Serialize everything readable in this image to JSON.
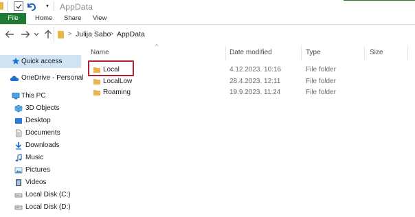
{
  "window": {
    "title": "AppData"
  },
  "ribbon": {
    "tabs": [
      "File",
      "Home",
      "Share",
      "View"
    ]
  },
  "address": {
    "crumbs": [
      "Julija Sabo",
      "AppData"
    ]
  },
  "sidebar": {
    "quick_access": "Quick access",
    "onedrive": "OneDrive - Personal",
    "this_pc": "This PC",
    "items": [
      "3D Objects",
      "Desktop",
      "Documents",
      "Downloads",
      "Music",
      "Pictures",
      "Videos",
      "Local Disk (C:)",
      "Local Disk (D:)"
    ]
  },
  "columns": {
    "name": "Name",
    "date": "Date modified",
    "type": "Type",
    "size": "Size"
  },
  "files": [
    {
      "name": "Local",
      "date": "4.12.2023. 10:16",
      "type": "File folder"
    },
    {
      "name": "LocalLow",
      "date": "28.4.2023. 12:11",
      "type": "File folder"
    },
    {
      "name": "Roaming",
      "date": "19.9.2023. 11:24",
      "type": "File folder"
    }
  ],
  "colors": {
    "file_tab": "#1e7b34",
    "folder": "#e9b44c",
    "selection": "#cfe3f5",
    "highlight": "#b3232f"
  }
}
